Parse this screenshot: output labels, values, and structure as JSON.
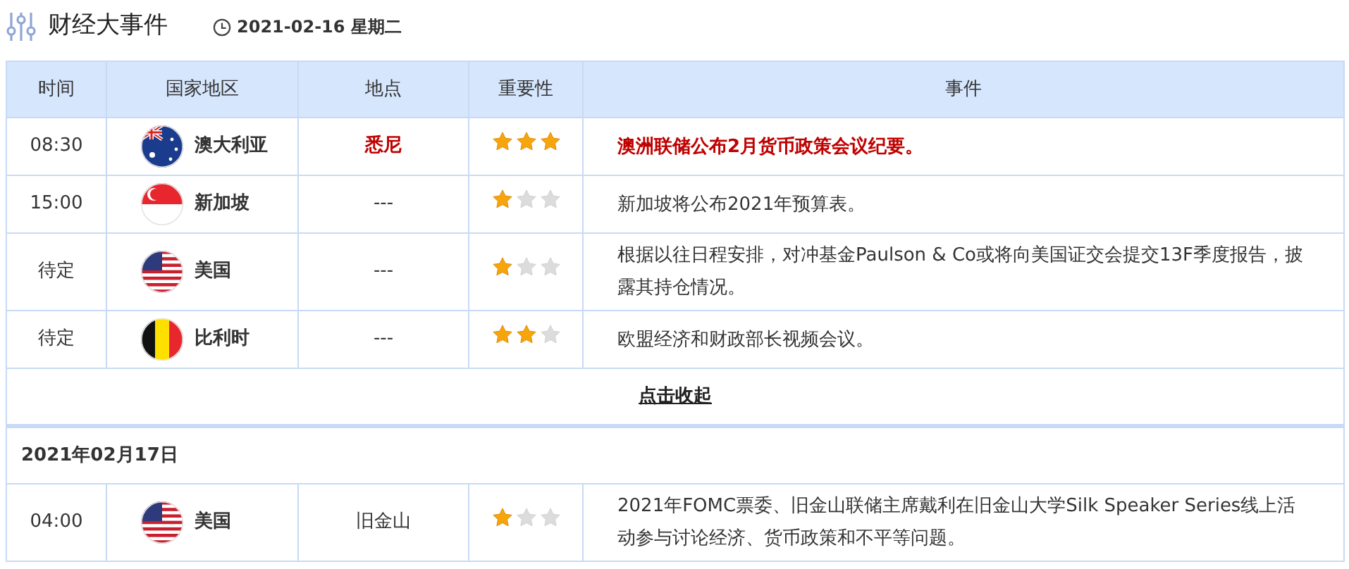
{
  "header": {
    "title": "财经大事件",
    "date": "2021-02-16 星期二"
  },
  "table": {
    "columns": [
      "时间",
      "国家地区",
      "地点",
      "重要性",
      "事件"
    ],
    "rows": [
      {
        "time": "08:30",
        "kind": "australia",
        "country": "澳大利亚",
        "location": "悉尼",
        "stars": 3,
        "event": "澳洲联储公布2月货币政策会议纪要。",
        "important": true
      },
      {
        "time": "15:00",
        "kind": "singapore",
        "country": "新加坡",
        "location": "---",
        "stars": 1,
        "event": "新加坡将公布2021年预算表。",
        "important": false
      },
      {
        "time": "待定",
        "kind": "usa",
        "country": "美国",
        "location": "---",
        "stars": 1,
        "event": "根据以往日程安排，对冲基金Paulson & Co或将向美国证交会提交13F季度报告，披露其持仓情况。",
        "important": false
      },
      {
        "time": "待定",
        "kind": "belgium",
        "country": "比利时",
        "location": "---",
        "stars": 2,
        "event": "欧盟经济和财政部长视频会议。",
        "important": false
      }
    ],
    "collapse_link": "点击收起",
    "next_day": {
      "date": "2021年02月17日",
      "rows": [
        {
          "time": "04:00",
          "kind": "usa",
          "country": "美国",
          "location": "旧金山",
          "stars": 1,
          "event": "2021年FOMC票委、旧金山联储主席戴利在旧金山大学Silk Speaker Series线上活动参与讨论经济、货币政策和不平等问题。",
          "important": false
        }
      ]
    }
  }
}
